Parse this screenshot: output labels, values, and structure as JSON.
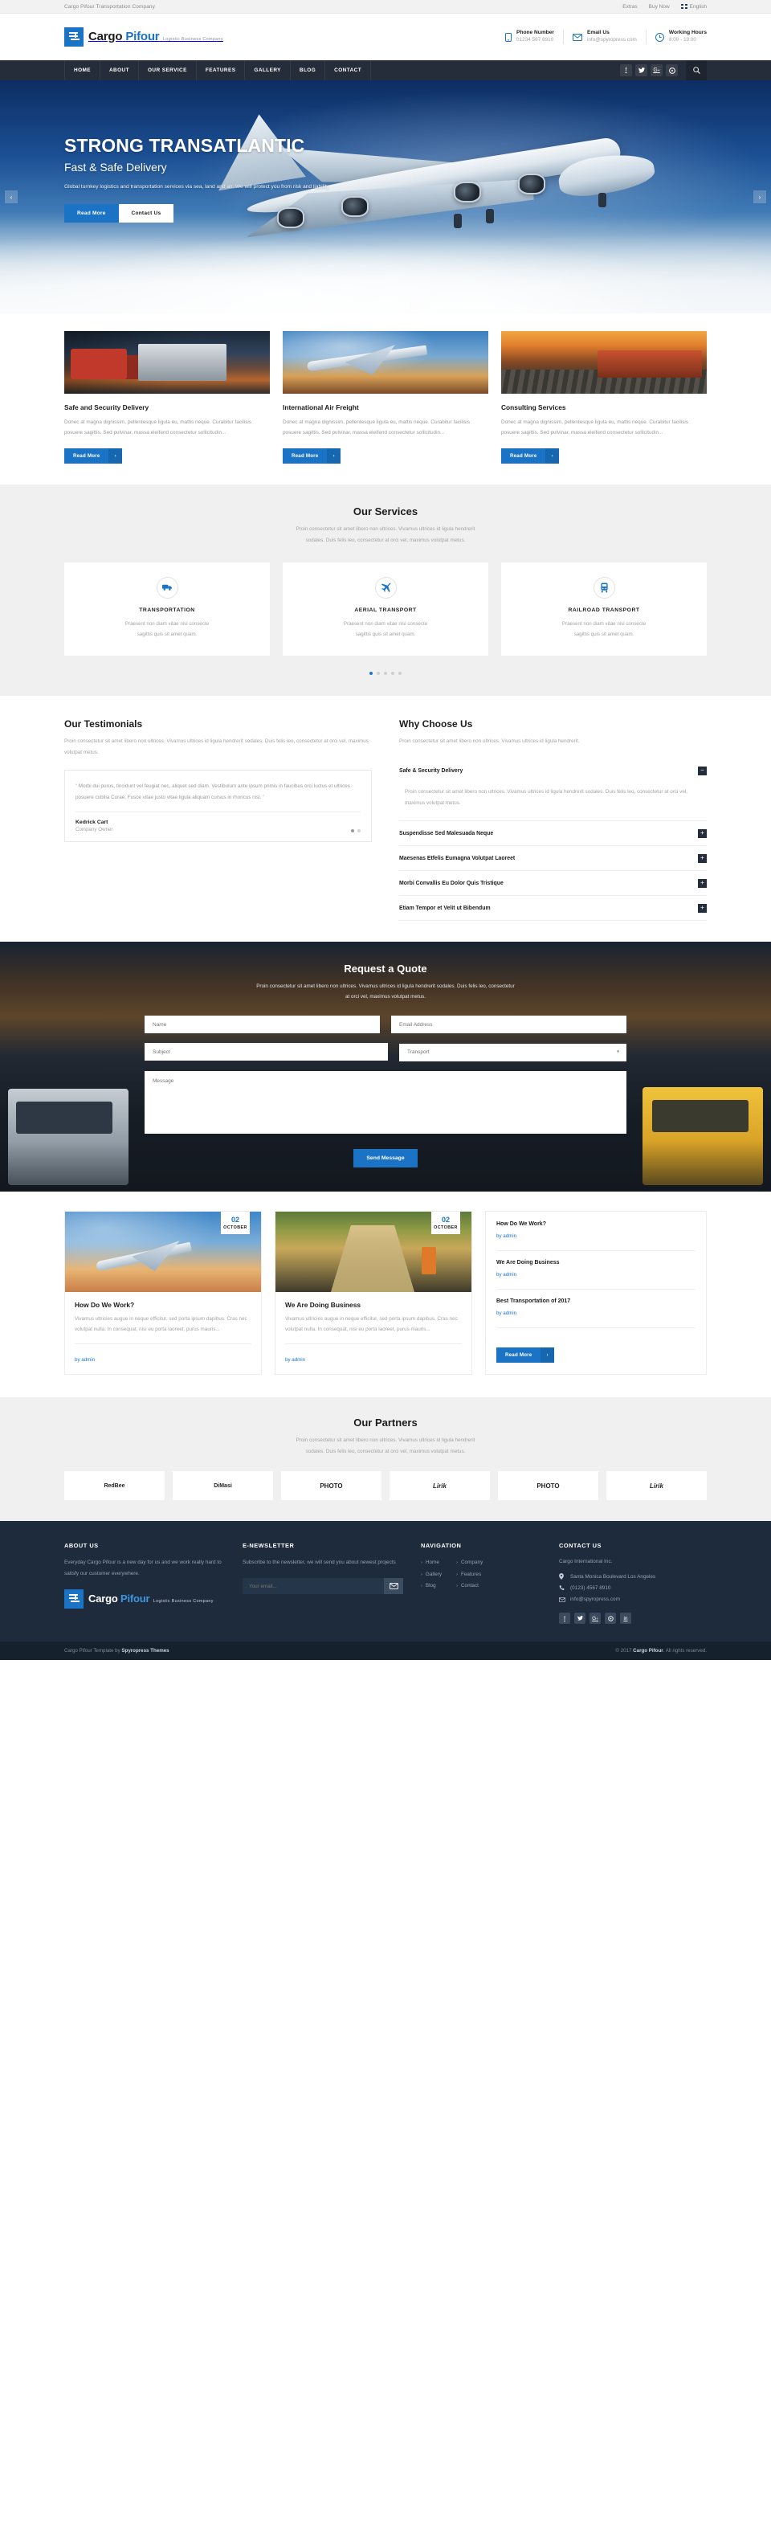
{
  "topbar": {
    "tagline": "Cargo Pifour Transportation Company",
    "links": [
      "Extras",
      "Buy Now"
    ],
    "language": "English"
  },
  "brand": {
    "name_1": "Cargo",
    "name_2": "Pifour",
    "tagline": "Logistic Business Company"
  },
  "header": {
    "contacts": [
      {
        "icon": "phone-icon",
        "title": "Phone Number",
        "value": "01234 567 8910"
      },
      {
        "icon": "envelope-icon",
        "title": "Email Us",
        "value": "info@spyropress.com"
      },
      {
        "icon": "clock-icon",
        "title": "Working Hours",
        "value": "8:00 - 19:00"
      }
    ]
  },
  "nav": {
    "items": [
      "HOME",
      "ABOUT",
      "OUR SERVICE",
      "FEATURES",
      "GALLERY",
      "BLOG",
      "CONTACT"
    ],
    "social": [
      "facebook-icon",
      "twitter-icon",
      "google-plus-icon",
      "pinterest-icon"
    ],
    "search": "search-icon"
  },
  "hero": {
    "title": "STRONG TRANSATLANTIC",
    "subtitle": "Fast & Safe Delivery",
    "text": "Global turnkey logistics and transportation services via sea, land and air. We will protect you from risk and liability.",
    "btn_primary": "Read More",
    "btn_secondary": "Contact Us",
    "arrow_left": "‹",
    "arrow_right": "›"
  },
  "features": {
    "cards": [
      {
        "thumb": "truck-photo",
        "title": "Safe and Security Delivery",
        "text": "Donec at magna dignissim, pellentesque ligula eu, mattis neque. Curabitur facilisis posuere sagittis. Sed pulvinar, massa eleifend consectetur sollicitudin...",
        "button": "Read More"
      },
      {
        "thumb": "airplane-photo",
        "title": "International Air Freight",
        "text": "Donec at magna dignissim, pellentesque ligula eu, mattis neque. Curabitur facilisis posuere sagittis. Sed pulvinar, massa eleifend consectetur sollicitudin...",
        "button": "Read More"
      },
      {
        "thumb": "train-photo",
        "title": "Consulting Services",
        "text": "Donec at magna dignissim, pellentesque ligula eu, mattis neque. Curabitur facilisis posuere sagittis. Sed pulvinar, massa eleifend consectetur sollicitudin...",
        "button": "Read More"
      }
    ]
  },
  "services": {
    "title": "Our Services",
    "sub_1": "Proin consectetur sit amet libero non ultrices. Vivamus ultrices id ligula hendrerit",
    "sub_2": "sodales. Duis felis leo, consectetur at orci vel, maximus volutpat metus.",
    "boxes": [
      {
        "icon": "truck-icon",
        "title": "TRANSPORTATION",
        "text_1": "Praesent non diam vitae nisl consecte",
        "text_2": "sagittis quis sit amet quam."
      },
      {
        "icon": "airplane-icon",
        "title": "AERIAL TRANSPORT",
        "text_1": "Praesent non diam vitae nisl consecte",
        "text_2": "sagittis quis sit amet quam."
      },
      {
        "icon": "train-icon",
        "title": "RAILROAD TRANSPORT",
        "text_1": "Praesent non diam vitae nisl consecte",
        "text_2": "sagittis quis sit amet quam."
      }
    ],
    "dots_count": 5,
    "dots_active": 0
  },
  "testimonials": {
    "title": "Our Testimonials",
    "sub": "Proin consectetur sit amet libero non ultrices. Vivamus ultrices id ligula hendrerit sodales. Duis felis leo, consectetur at orci vel, maximus volutpat metus.",
    "quote": "Morbi dui purus, tincidunt vel feugiat nec, aliquet sed diam. Vestibulum ante ipsum primis in faucibus orci luctus et ultrices posuere cubilia Curae; Fusce vitae justo vitae ligula aliquam cursus in rhoncus nisl.",
    "quote_open": "“",
    "quote_close": "”",
    "author_name": "Kedrick Cart",
    "author_role": "Company Owner"
  },
  "why": {
    "title": "Why Choose Us",
    "sub": "Proin consectetur sit amet libero non ultrices. Vivamus ultrices id ligula hendrerit.",
    "items": [
      {
        "title": "Safe & Security Delivery",
        "toggle": "−",
        "open": true,
        "body": "Proin consectetur sit amet libero non ultrices. Vivamus ultrices id ligula hendrerit sodales. Duis felis leo, consectetur at orci vel, maximus volutpat metus."
      },
      {
        "title": "Suspendisse Sed Malesuada Neque",
        "toggle": "+",
        "open": false,
        "body": ""
      },
      {
        "title": "Maesenas Etfelis Eumagna Volutpat Laoreet",
        "toggle": "+",
        "open": false,
        "body": ""
      },
      {
        "title": "Morbi Convallis Eu Dolor Quis Tristique",
        "toggle": "+",
        "open": false,
        "body": ""
      },
      {
        "title": "Etiam Tempor et Velit ut Bibendum",
        "toggle": "+",
        "open": false,
        "body": ""
      }
    ]
  },
  "quote_form": {
    "title": "Request a Quote",
    "sub_1": "Proin consectetur sit amet libero non ultrices. Vivamus ultrices id ligula hendrerit sodales. Duis felis leo, consectetur",
    "sub_2": "at orci vel, maximus volutpat metus.",
    "name_placeholder": "Name",
    "email_placeholder": "Email Address",
    "subject_placeholder": "Subject",
    "select_value": "Transport",
    "message_placeholder": "Message",
    "submit": "Send Message"
  },
  "blog": {
    "posts": [
      {
        "thumb": "airplane-photo",
        "day": "02",
        "month": "OCTOBER",
        "title": "How Do We Work?",
        "text": "Vivamus ultricies augue in neque efficitur, sed porta ipsum dapibus. Cras nec volutpat nulla. In consequat, nisi eu porta laoreet, purus mauris...",
        "author": "by admin"
      },
      {
        "thumb": "highway-photo",
        "day": "02",
        "month": "OCTOBER",
        "title": "We Are Doing Business",
        "text": "Vivamus ultricies augue in neque efficitur, sed porta ipsum dapibus. Cras nec volutpat nulla. In consequat, nisi eu porta laoreet, purus mauris...",
        "author": "by admin"
      }
    ],
    "sidebar": {
      "items": [
        {
          "title": "How Do We Work?",
          "author": "by admin"
        },
        {
          "title": "We Are Doing Business",
          "author": "by admin"
        },
        {
          "title": "Best Transportation of 2017",
          "author": "by admin"
        }
      ],
      "button": "Read More"
    }
  },
  "partners": {
    "title": "Our Partners",
    "sub_1": "Proin consectetur sit amet libero non ultrices. Vivamus ultrices id ligula hendrerit",
    "sub_2": "sodales. Duis felis leo, consectetur at orci vel, maximus volutpat metus.",
    "logos": [
      "RedBee",
      "DiMasi",
      "PHOTO",
      "Lirik",
      "PHOTO",
      "Lirik"
    ]
  },
  "footer": {
    "about": {
      "heading": "ABOUT US",
      "text": "Everyday Cargo Pifour  is a new day for us and we work really hard to satisfy our customer everywhere."
    },
    "newsletter": {
      "heading": "E-NEWSLETTER",
      "text": "Subscribe to the newsletter, we will send you about newest projects",
      "placeholder": "Your email...",
      "button_icon": "envelope-icon"
    },
    "navigation": {
      "heading": "NAVIGATION",
      "col_1": [
        "Home",
        "Gallery",
        "Blog"
      ],
      "col_2": [
        "Company",
        "Features",
        "Contact"
      ]
    },
    "contact": {
      "heading": "CONTACT US",
      "company": "Cargo International Inc.",
      "address": "Santa Monica Boulevard Los Angeles",
      "phone": "(0123) 4567 8910",
      "email": "info@spyropress.com",
      "social": [
        "facebook-icon",
        "twitter-icon",
        "google-plus-icon",
        "pinterest-icon",
        "linkedin-icon"
      ]
    }
  },
  "bottombar": {
    "left_pre": "Cargo Pifour Template by ",
    "left_bold": "Spyropress Themes",
    "right_pre": "© 2017 ",
    "right_bold": "Cargo Pifour",
    "right_post": ". All rights reserved."
  }
}
